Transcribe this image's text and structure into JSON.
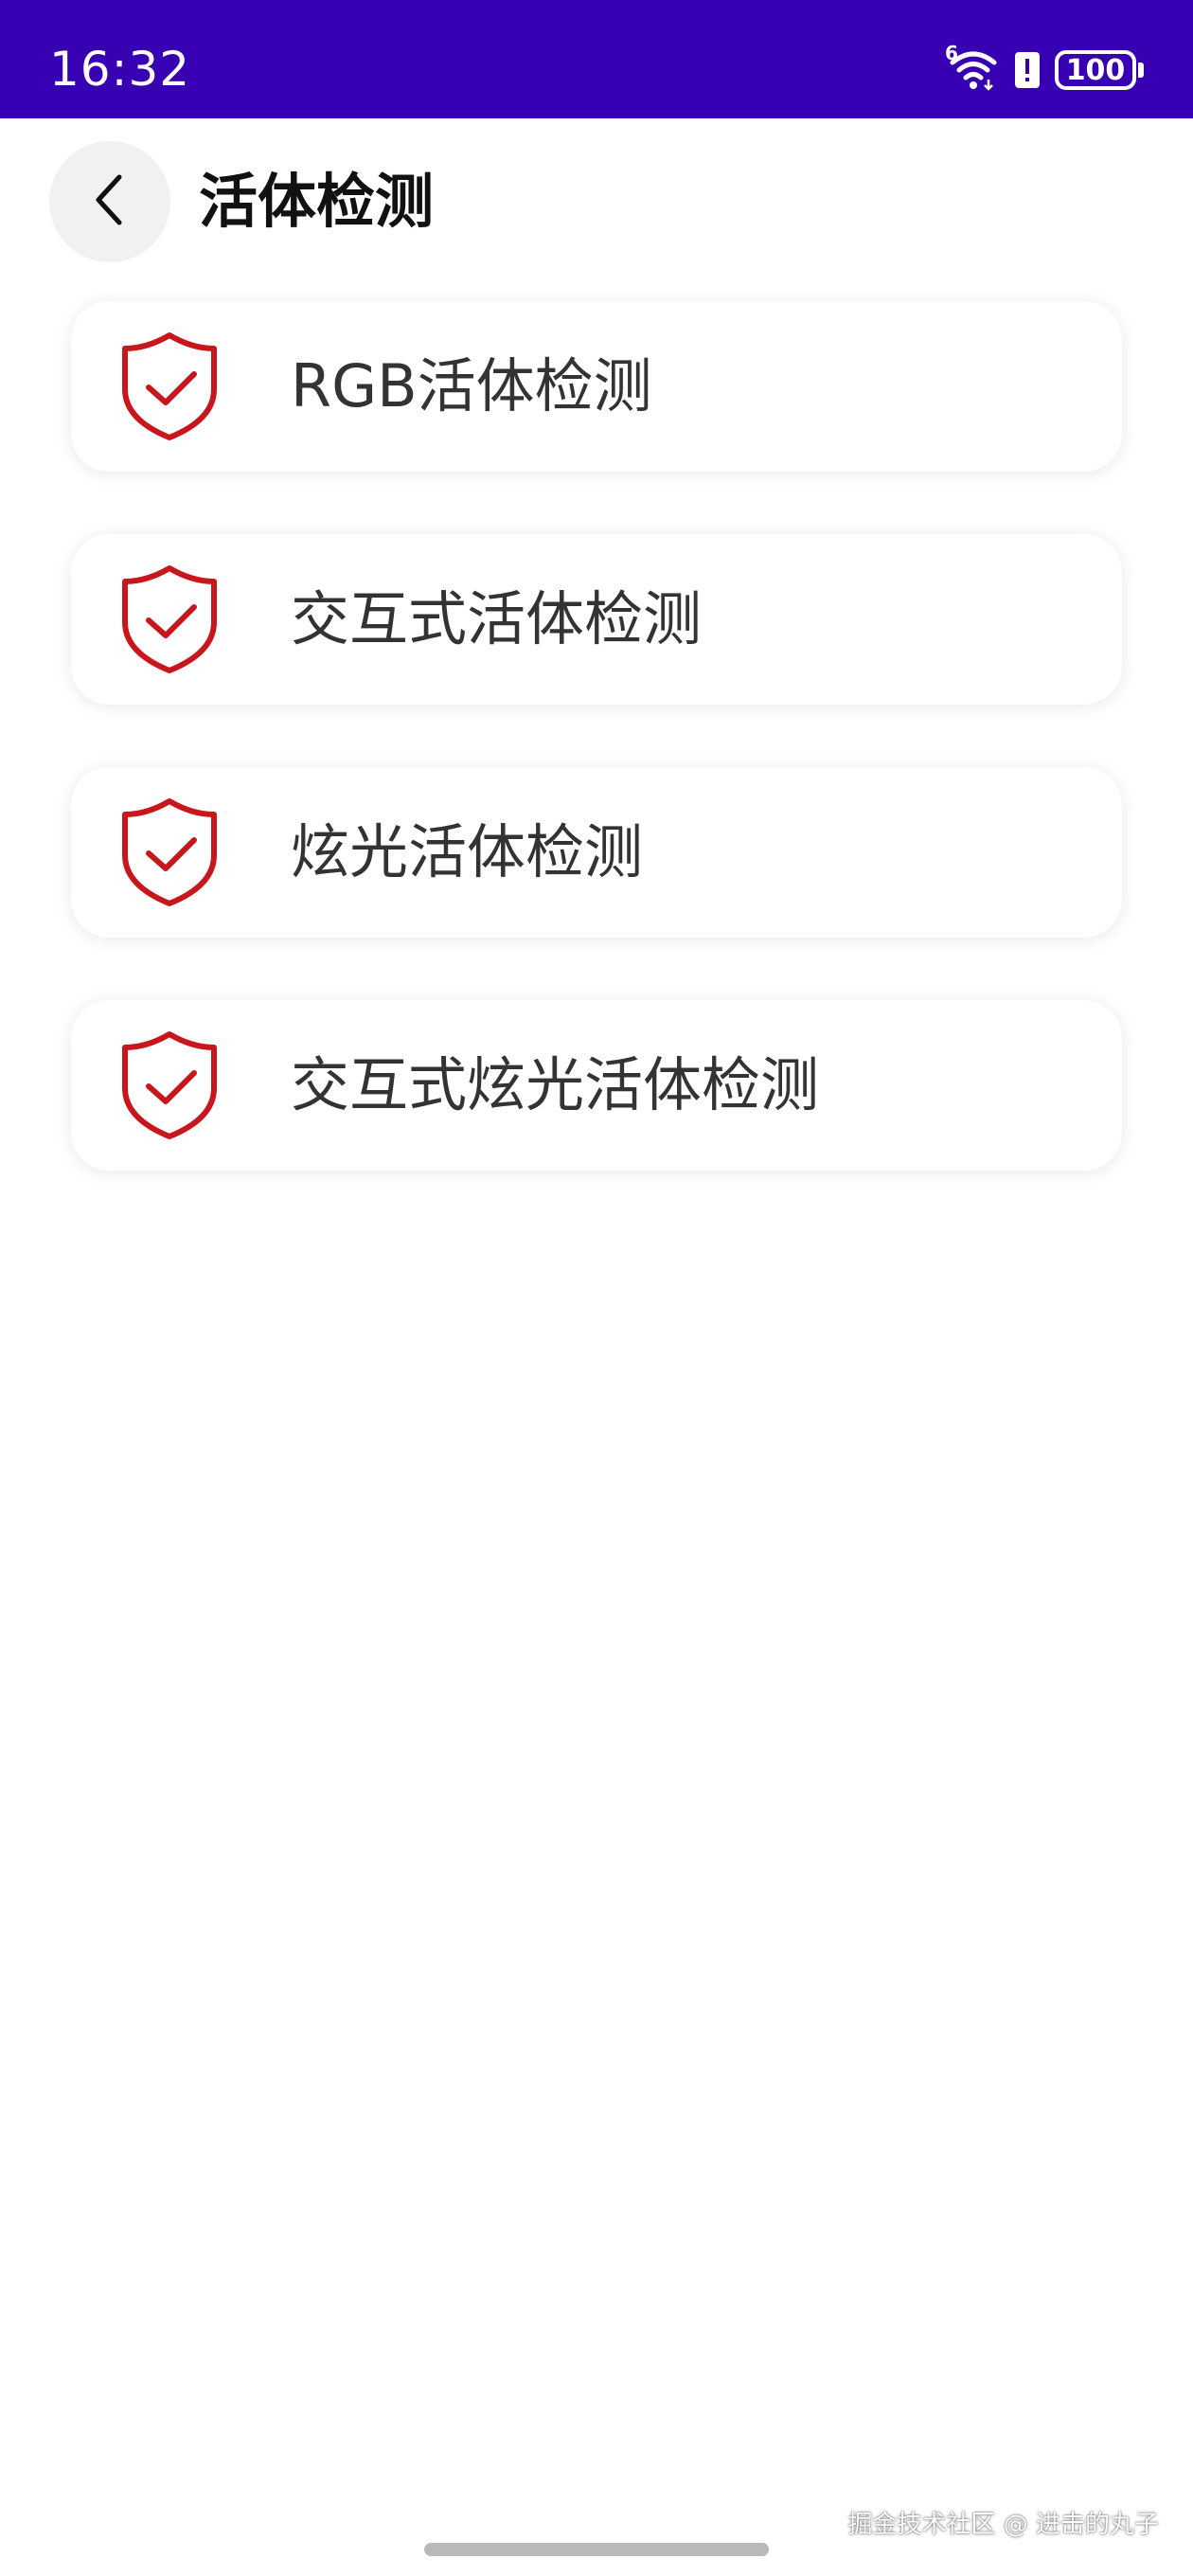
{
  "status_bar": {
    "time": "16:32",
    "network_label": "6",
    "battery_level": "100",
    "background_color": "#3700b3",
    "icons": [
      "wifi-icon",
      "alert-icon",
      "battery-icon"
    ]
  },
  "header": {
    "title": "活体检测",
    "back_icon": "chevron-left-icon"
  },
  "menu": {
    "items": [
      {
        "label": "RGB活体检测",
        "icon": "shield-check-icon"
      },
      {
        "label": "交互式活体检测",
        "icon": "shield-check-icon"
      },
      {
        "label": "炫光活体检测",
        "icon": "shield-check-icon"
      },
      {
        "label": "交互式炫光活体检测",
        "icon": "shield-check-icon"
      }
    ],
    "icon_color": "#c8161d"
  },
  "watermark": {
    "text": "掘金技术社区 @ 进击的丸子"
  }
}
